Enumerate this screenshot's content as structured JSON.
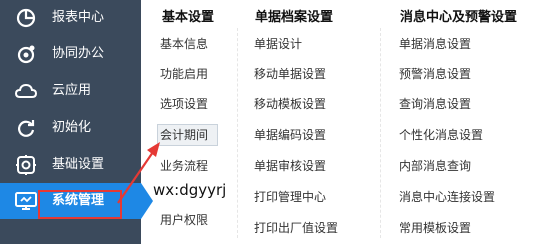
{
  "sidebar": {
    "items": [
      {
        "label": "报表中心",
        "icon": "report-pie-icon"
      },
      {
        "label": "协同办公",
        "icon": "collaboration-icon"
      },
      {
        "label": "云应用",
        "icon": "cloud-icon"
      },
      {
        "label": "初始化",
        "icon": "refresh-icon"
      },
      {
        "label": "基础设置",
        "icon": "gear-icon"
      },
      {
        "label": "系统管理",
        "icon": "monitor-settings-icon",
        "active": true
      }
    ]
  },
  "columns": [
    {
      "title": "基本设置",
      "items": [
        "基本信息",
        "功能启用",
        "选项设置",
        "会计期间",
        "业务流程",
        "用户权限"
      ]
    },
    {
      "title": "单据档案设置",
      "items": [
        "单据设计",
        "移动单据设置",
        "移动模板设置",
        "单据编码设置",
        "单据审核设置",
        "打印管理中心",
        "打印出厂值设置"
      ]
    },
    {
      "title": "消息中心及预警设置",
      "items": [
        "单据消息设置",
        "预警消息设置",
        "查询消息设置",
        "个性化消息设置",
        "内部消息查询",
        "消息中心连接设置",
        "常用模板设置"
      ]
    }
  ],
  "overlay": {
    "watermark": "wx:dgyyrj"
  },
  "colors": {
    "sidebar_bg": "#3b4a5c",
    "active_bg": "#1e88e5",
    "annotation_red": "#e53935"
  }
}
